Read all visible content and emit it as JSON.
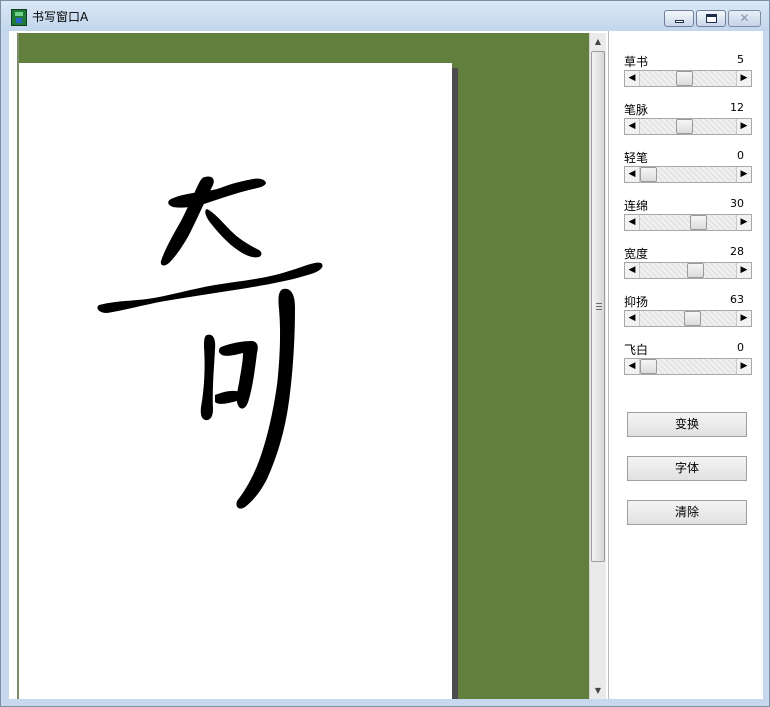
{
  "window": {
    "title": "书写窗口A",
    "app_icon": "calligraphy-app-icon",
    "minimize_glyph": "minimize-icon",
    "maximize_glyph": "restore-icon",
    "close_glyph": "✕"
  },
  "scrollbar": {
    "up_arrow": "▲",
    "down_arrow": "▼"
  },
  "controls": [
    {
      "label": "草书",
      "value": "5",
      "level": 0.45,
      "left_arrow": "◀",
      "right_arrow": "▶"
    },
    {
      "label": "笔脉",
      "value": "12",
      "level": 0.44,
      "left_arrow": "◀",
      "right_arrow": "▶"
    },
    {
      "label": "轻笔",
      "value": "0",
      "level": 0.0,
      "left_arrow": "◀",
      "right_arrow": "▶"
    },
    {
      "label": "连绵",
      "value": "30",
      "level": 0.62,
      "left_arrow": "◀",
      "right_arrow": "▶"
    },
    {
      "label": "宽度",
      "value": "28",
      "level": 0.58,
      "left_arrow": "◀",
      "right_arrow": "▶"
    },
    {
      "label": "抑扬",
      "value": "63",
      "level": 0.54,
      "left_arrow": "◀",
      "right_arrow": "▶"
    },
    {
      "label": "飞白",
      "value": "0",
      "level": 0.0,
      "left_arrow": "◀",
      "right_arrow": "▶"
    }
  ],
  "buttons": {
    "transform": "变换",
    "font": "字体",
    "clear": "清除"
  },
  "colors": {
    "canvas_background": "#627f3d",
    "paper": "#ffffff",
    "ink": "#000000"
  }
}
